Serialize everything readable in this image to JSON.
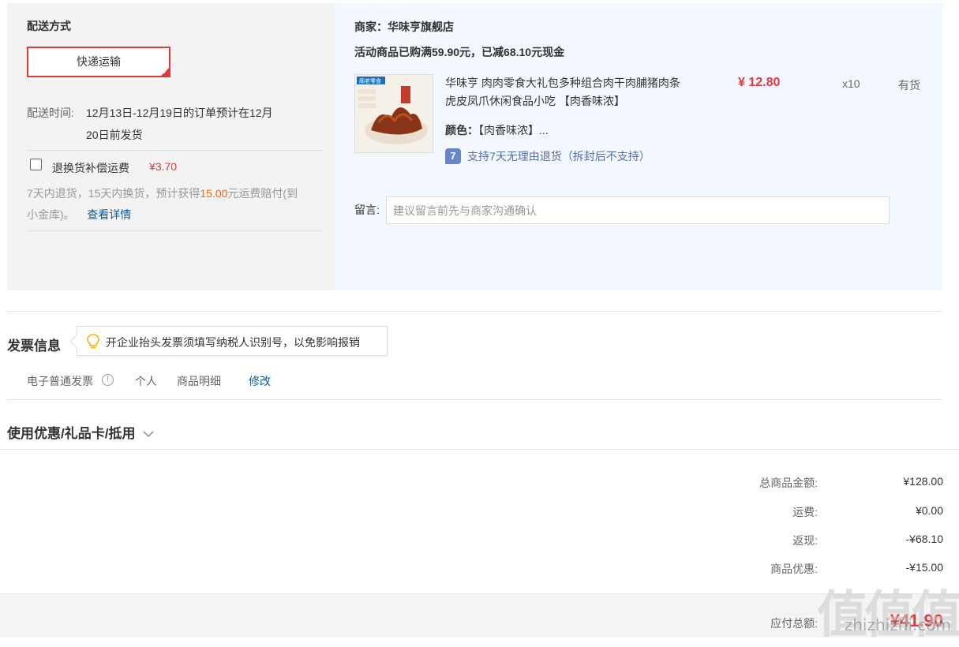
{
  "shipping": {
    "title": "配送方式",
    "method": "快递运输",
    "time_label": "配送时间:",
    "time_value": "12月13日-12月19日的订单预计在12月",
    "time_value2": "20日前发货",
    "insurance_label": "退换货补偿运费",
    "insurance_price": "¥3.70",
    "note_part1": "7天内退货，15天内换货，预计获得",
    "note_amount": "15.00",
    "note_part2": "元运费赔付(到",
    "note_part3": "小金库)。",
    "details_link": "查看详情"
  },
  "product": {
    "store_label": "商家：",
    "store_name": "华味亨旗舰店",
    "promo": "活动商品已购满59.90元，已减68.10元现金",
    "title": "华味亨 肉肉零食大礼包多种组合肉干肉脯猪肉条虎皮凤爪休闲食品小吃 【肉香味浓】",
    "color_label": "颜色：",
    "color_value": "【肉香味浓】...",
    "price": "¥ 12.80",
    "qty": "x10",
    "stock": "有货",
    "return_badge": "7",
    "return_text": "支持7天无理由退货（拆封后不支持）",
    "thumb_text": "阁老零食",
    "note_label": "留言:",
    "note_placeholder": "建议留言前先与商家沟通确认"
  },
  "invoice": {
    "title": "发票信息",
    "tip": "开企业抬头发票须填写纳税人识别号，以免影响报销",
    "type": "电子普通发票",
    "info_icon": "!",
    "person": "个人",
    "detail": "商品明细",
    "modify": "修改"
  },
  "coupon": {
    "title": "使用优惠/礼品卡/抵用",
    "chevron": "∨"
  },
  "summary": {
    "rows": [
      {
        "label": "总商品金额:",
        "value": "¥128.00"
      },
      {
        "label": "运费:",
        "value": "¥0.00"
      },
      {
        "label": "返现:",
        "value": "-¥68.10"
      },
      {
        "label": "商品优惠:",
        "value": "-¥15.00"
      }
    ],
    "total_label": "应付总额:",
    "total_value": "¥41.90"
  },
  "watermark": {
    "text": "值值值",
    "url": "zhizhizhi.com"
  }
}
